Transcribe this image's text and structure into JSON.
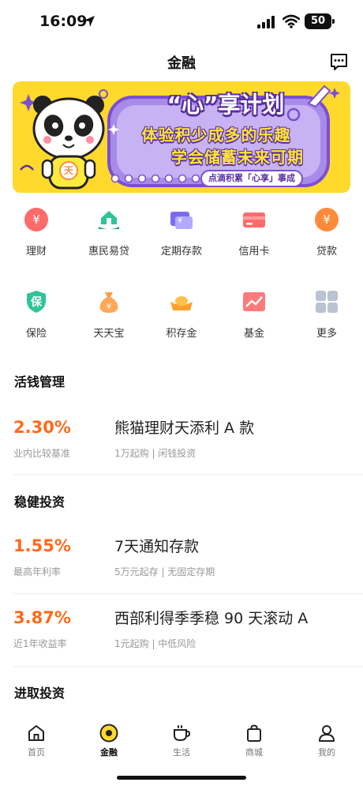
{
  "status_bar": {
    "time": "16:09",
    "battery": "50"
  },
  "header": {
    "title": "金融"
  },
  "banner": {
    "title_chars": [
      "“心”",
      "享",
      "计",
      "划"
    ],
    "line1": "体验积少成多的乐趣",
    "line2": "学会储蓄未来可期",
    "tag": "点滴积累「心享」事成",
    "mascot_badge": "天"
  },
  "quick_menu": [
    {
      "label": "理财",
      "icon": "yuan-coin-icon",
      "color": "#ff5a5a"
    },
    {
      "label": "惠民易贷",
      "icon": "house-hand-icon",
      "color": "#1fb58a"
    },
    {
      "label": "定期存款",
      "icon": "deposit-card-icon",
      "color": "#7a6cf0"
    },
    {
      "label": "信用卡",
      "icon": "credit-card-icon",
      "color": "#ff5a5a"
    },
    {
      "label": "贷款",
      "icon": "loan-coin-icon",
      "color": "#ff8a3a"
    },
    {
      "label": "保险",
      "icon": "shield-icon",
      "color": "#1fb58a",
      "glyph": "保"
    },
    {
      "label": "天天宝",
      "icon": "money-bag-icon",
      "color": "#ff8a3a"
    },
    {
      "label": "积存金",
      "icon": "gold-ingot-icon",
      "color": "#ffa23a"
    },
    {
      "label": "基金",
      "icon": "trend-chart-icon",
      "color": "#ff5a5a"
    },
    {
      "label": "更多",
      "icon": "grid-more-icon",
      "color": "#9aa6b8"
    }
  ],
  "sections": {
    "flexible": {
      "title": "活钱管理",
      "products": [
        {
          "rate": "2.30%",
          "rate_label": "业内比较基准",
          "name": "熊猫理财天添利 A 款",
          "desc": "1万起购 | 闲钱投资"
        }
      ]
    },
    "stable": {
      "title": "稳健投资",
      "products": [
        {
          "rate": "1.55%",
          "rate_label": "最高年利率",
          "name": "7天通知存款",
          "desc": "5万元起存 | 无固定存期"
        },
        {
          "rate": "3.87%",
          "rate_label": "近1年收益率",
          "name": "西部利得季季稳 90 天滚动 A",
          "desc": "1元起购 | 中低风险"
        }
      ]
    },
    "aggressive": {
      "title": "进取投资"
    }
  },
  "bottom_nav": [
    {
      "label": "首页",
      "icon": "home-icon"
    },
    {
      "label": "金融",
      "icon": "finance-coin-icon",
      "active": true
    },
    {
      "label": "生活",
      "icon": "coffee-cup-icon"
    },
    {
      "label": "商城",
      "icon": "shopping-bag-icon"
    },
    {
      "label": "我的",
      "icon": "person-icon"
    }
  ],
  "colors": {
    "accent": "#ff6a1a",
    "brand_yellow": "#ffd92c",
    "banner_purple": "#7b4fd0"
  }
}
